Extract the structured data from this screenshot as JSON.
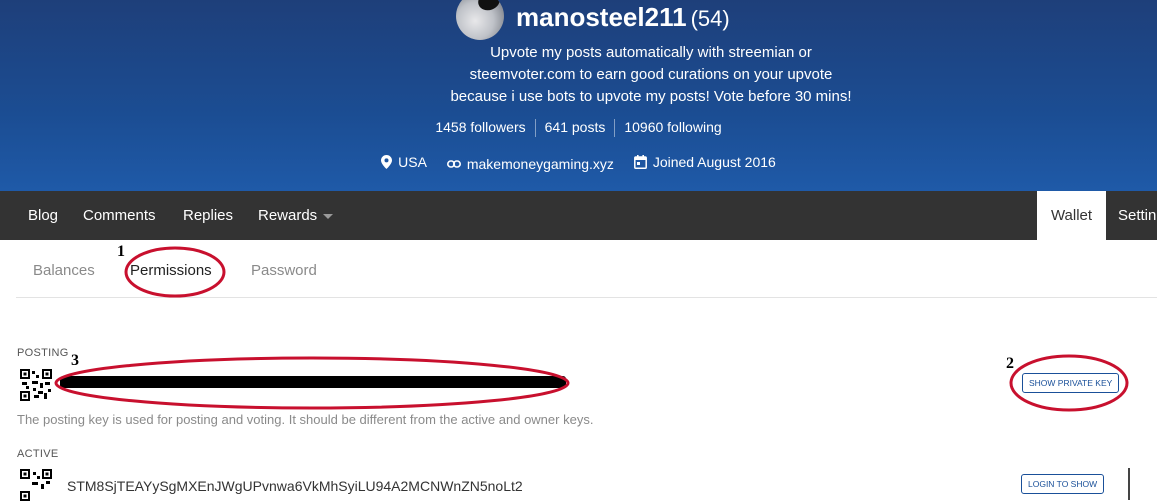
{
  "profile": {
    "username": "manosteel211",
    "reputation": "(54)",
    "about_lines": [
      "Upvote my posts automatically with streemian or",
      "steemvoter.com to earn good curations on your upvote",
      "because i use bots to upvote my posts! Vote before 30 mins!"
    ],
    "stats": {
      "followers": "1458 followers",
      "posts": "641 posts",
      "following": "10960 following"
    },
    "location": "USA",
    "website": "makemoneygaming.xyz",
    "joined": "Joined August 2016",
    "icons": {
      "location": "map-pin-icon",
      "website": "link-icon",
      "joined": "calendar-icon"
    }
  },
  "nav": {
    "items": [
      "Blog",
      "Comments",
      "Replies",
      "Rewards"
    ],
    "wallet": "Wallet",
    "settings": "Settings"
  },
  "subtabs": {
    "balances": "Balances",
    "permissions": "Permissions",
    "password": "Password"
  },
  "posting": {
    "label": "POSTING",
    "button": "SHOW PRIVATE KEY",
    "hint": "The posting key is used for posting and voting. It should be different from the active and owner keys."
  },
  "active": {
    "label": "ACTIVE",
    "key": "STM8SjTEAYySgMXEnJWgUPvnwa6VkMhSyiLU94A2MCNWnZN5noLt2",
    "button": "LOGIN TO SHOW"
  },
  "annotations": [
    "1",
    "2",
    "3"
  ],
  "colors": {
    "header": "#1e4c8f",
    "nav": "#333333",
    "annotation": "#c8102e",
    "button": "#1a5099"
  }
}
